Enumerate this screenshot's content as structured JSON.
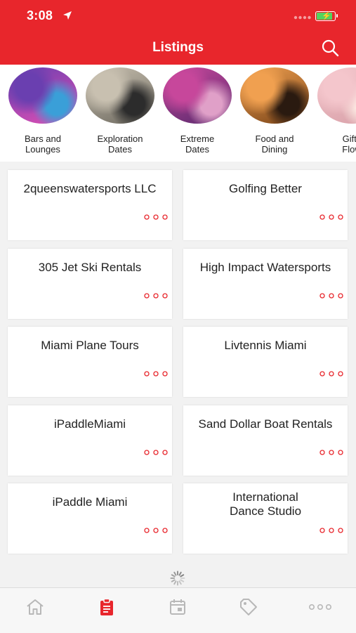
{
  "status_bar": {
    "time": "3:08"
  },
  "header": {
    "title": "Listings"
  },
  "categories": [
    {
      "label": "Bars and\nLounges",
      "image": "bar-lounge-photo",
      "colors": [
        "#6a3fb0",
        "#e14fb4",
        "#3a9fd8"
      ]
    },
    {
      "label": "Exploration\nDates",
      "image": "airboat-photo",
      "colors": [
        "#c8c0b0",
        "#6e6a60",
        "#2c2c2c"
      ]
    },
    {
      "label": "Extreme\nDates",
      "image": "pole-fitness-photo",
      "colors": [
        "#c7479b",
        "#5a2a6e",
        "#e0a0c8"
      ]
    },
    {
      "label": "Food and\nDining",
      "image": "restaurant-photo",
      "colors": [
        "#f0a050",
        "#7a4418",
        "#2a1a10"
      ]
    },
    {
      "label": "Gifts\nFlow",
      "image": "flowers-photo",
      "colors": [
        "#f4c6cc",
        "#d8a0a8",
        "#fbe6e0"
      ]
    }
  ],
  "listings": [
    "2queenswatersports LLC",
    "Golfing Better",
    "305 Jet Ski Rentals",
    "High Impact Watersports",
    "Miami Plane Tours",
    "Livtennis Miami",
    "iPaddleMiami",
    "Sand Dollar Boat Rentals",
    "iPaddle Miami",
    "International\nDance Studio"
  ],
  "tab_bar": [
    {
      "name": "home-icon",
      "active": false
    },
    {
      "name": "listings-icon",
      "active": true
    },
    {
      "name": "calendar-icon",
      "active": false
    },
    {
      "name": "tag-icon",
      "active": false
    },
    {
      "name": "more-icon",
      "active": false
    }
  ],
  "colors": {
    "brand": "#e8262c",
    "inactive_icon": "#b8b8b8",
    "more_dots": "#e8262c"
  }
}
